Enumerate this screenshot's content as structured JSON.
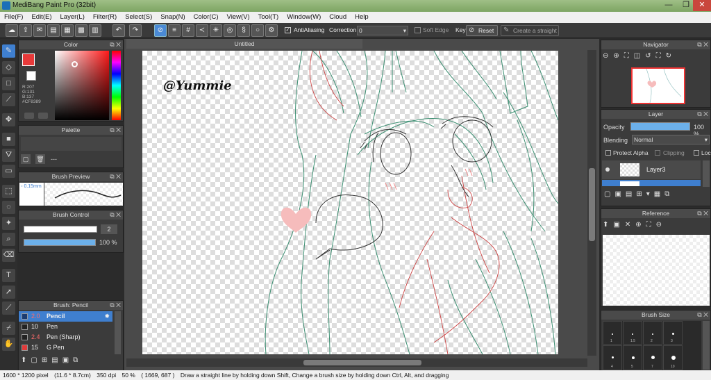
{
  "window": {
    "title": "MediBang Paint Pro (32bit)",
    "minimize": "—",
    "maximize": "❐",
    "close": "✕"
  },
  "menu": [
    "File(F)",
    "Edit(E)",
    "Layer(L)",
    "Filter(R)",
    "Select(S)",
    "Snap(N)",
    "Color(C)",
    "View(V)",
    "Tool(T)",
    "Window(W)",
    "Cloud",
    "Help"
  ],
  "toolbar": {
    "antialiasing": "AntiAliasing",
    "correction_label": "Correction",
    "correction_value": "0",
    "soft_edge": "Soft Edge",
    "key_label": "Key",
    "reset": "Reset",
    "create_straight": "Create a straight"
  },
  "color_panel": {
    "title": "Color",
    "r": "R:207",
    "g": "G:131",
    "b": "B:137",
    "hex": "#CF8389",
    "accent": "#e83a3a"
  },
  "palette_panel": {
    "title": "Palette",
    "value": "---"
  },
  "brush_preview": {
    "title": "Brush Preview",
    "size": "0.15mm"
  },
  "brush_control": {
    "title": "Brush Control",
    "size": "2",
    "opacity": "100 %"
  },
  "brush_list": {
    "title": "Brush: Pencil",
    "items": [
      {
        "size": "2.0",
        "name": "Pencil",
        "color": "#3f7fcf"
      },
      {
        "size": "10",
        "name": "Pen",
        "color": "#2b2b2b"
      },
      {
        "size": "2.4",
        "name": "Pen (Sharp)",
        "color": "#2b2b2b"
      },
      {
        "size": "15",
        "name": "G Pen",
        "color": "#e03a3a"
      }
    ]
  },
  "document": {
    "tab": "Untitled",
    "watermark": "@Yummie"
  },
  "navigator": {
    "title": "Navigator"
  },
  "layer_panel": {
    "title": "Layer",
    "opacity_label": "Opacity",
    "opacity_value": "100 %",
    "blending_label": "Blending",
    "blending_value": "Normal",
    "protect_alpha": "Protect Alpha",
    "clipping": "Clipping",
    "lock": "Lock",
    "layers": [
      {
        "name": "Layer3"
      }
    ]
  },
  "reference_panel": {
    "title": "Reference"
  },
  "brush_size_panel": {
    "title": "Brush Size",
    "labels": [
      "1",
      "1.5",
      "2",
      "3",
      "4",
      "5",
      "7",
      "10"
    ]
  },
  "status": {
    "dimensions": "1600 * 1200 pixel",
    "physical": "(11.6 * 8.7cm)",
    "dpi": "350 dpi",
    "zoom": "50 %",
    "coords": "( 1669, 687 )",
    "hint": "Draw a straight line by holding down Shift, Change a brush size by holding down Ctrl, Alt, and dragging"
  }
}
